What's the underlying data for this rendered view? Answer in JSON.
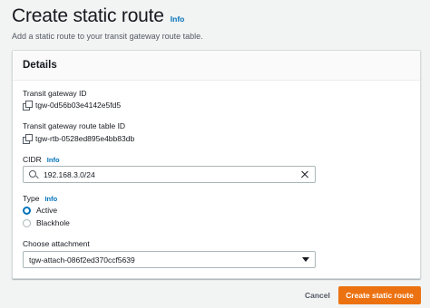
{
  "header": {
    "title": "Create static route",
    "info_label": "Info",
    "description": "Add a static route to your transit gateway route table."
  },
  "details": {
    "title": "Details",
    "transit_gateway_id": {
      "label": "Transit gateway ID",
      "value": "tgw-0d56b03e4142e5fd5",
      "icon": "copy-icon"
    },
    "route_table_id": {
      "label": "Transit gateway route table ID",
      "value": "tgw-rtb-0528ed895e4bb83db",
      "icon": "copy-icon"
    },
    "cidr": {
      "label": "CIDR",
      "info_label": "Info",
      "value": "192.168.3.0/24",
      "search_icon": "search-icon",
      "clear_icon": "clear-icon"
    },
    "type": {
      "label": "Type",
      "info_label": "Info",
      "options": [
        {
          "label": "Active",
          "checked": true
        },
        {
          "label": "Blackhole",
          "checked": false
        }
      ]
    },
    "attachment": {
      "label": "Choose attachment",
      "selected": "tgw-attach-086f2ed370ccf5639",
      "icon": "caret-down-icon"
    }
  },
  "actions": {
    "cancel_label": "Cancel",
    "create_label": "Create static route"
  },
  "colors": {
    "primary_button": "#ec7211",
    "link": "#0073bb",
    "background": "#f2f3f3"
  }
}
